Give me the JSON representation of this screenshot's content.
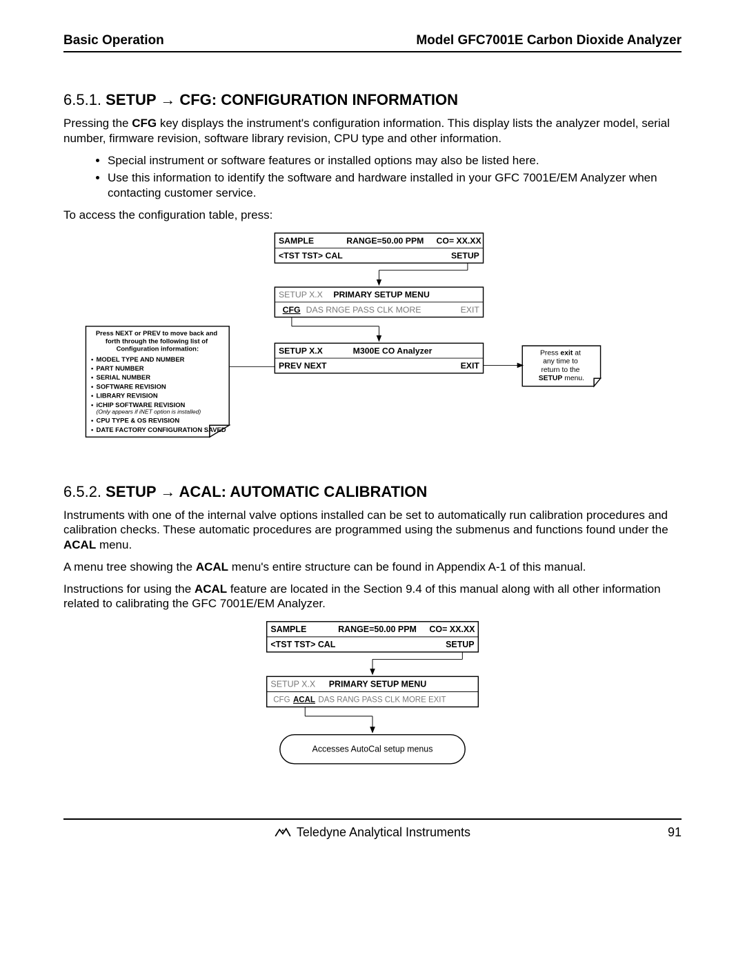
{
  "header": {
    "left": "Basic Operation",
    "right": "Model GFC7001E Carbon Dioxide Analyzer"
  },
  "section_651": {
    "number": "6.5.1.",
    "title_plain": "SETUP → CFG: CONFIGURATION INFORMATION",
    "title_pre": "SETUP ",
    "arrow": "→",
    "title_post": " CFG: CONFIGURATION INFORMATION",
    "para1_pre": "Pressing the ",
    "para1_bold": "CFG",
    "para1_post": " key displays the instrument's configuration information.  This display lists the analyzer model, serial number, firmware revision, software library revision, CPU type and other information.",
    "bullets": [
      "Special instrument or software features or installed options may also be listed here.",
      "Use this information to identify the software and hardware installed in your GFC 7001E/EM Analyzer when contacting customer service."
    ],
    "para2": "To access the configuration table, press:"
  },
  "diagram1": {
    "screen1": {
      "line1_left": "SAMPLE",
      "line1_mid": "RANGE=50.00 PPM",
      "line1_right": "CO= XX.XX",
      "line2_left": "<TST  TST>  CAL",
      "line2_right": "SETUP"
    },
    "screen2": {
      "line1_left": "SETUP X.X",
      "line1_mid": "PRIMARY SETUP MENU",
      "line2_bold": "CFG",
      "line2_rest": "DAS  RNGE  PASS  CLK  MORE",
      "line2_right": "EXIT"
    },
    "screen3": {
      "line1_left": "SETUP X.X",
      "line1_mid": "M300E CO Analyzer",
      "line2_left": "PREV NEXT",
      "line2_right": "EXIT"
    },
    "note_left": {
      "header": "Press NEXT or PREV to move back and forth through the following list of Configuration information:",
      "items": [
        "MODEL TYPE AND NUMBER",
        "PART NUMBER",
        "SERIAL NUMBER",
        "SOFTWARE REVISION",
        "LIBRARY REVISION"
      ],
      "ichip": "iCHIP SOFTWARE REVISION",
      "ichip_note": "(Only appears if iNET option is installed)",
      "items_after": [
        "CPU TYPE & OS REVISION",
        "DATE FACTORY CONFIGURATION SAVED"
      ]
    },
    "note_right": {
      "l1": "Press ",
      "l1b": "exit",
      "l1c": " at",
      "l2": "any time to",
      "l3": "return to the",
      "l4a": "SETUP",
      "l4b": " menu."
    }
  },
  "section_652": {
    "number": "6.5.2.",
    "title_pre": "SETUP ",
    "arrow": "→",
    "title_post": " ACAL: AUTOMATIC CALIBRATION",
    "para1_pre": "Instruments with one of the internal valve options installed can be set to automatically run calibration procedures and calibration checks.  These automatic procedures are programmed using the submenus and functions found under the ",
    "para1_bold": "ACAL",
    "para1_post": " menu.",
    "para2_pre": "A menu tree showing the ",
    "para2_bold": "ACAL",
    "para2_post": " menu's entire structure can be found in Appendix A-1 of this manual.",
    "para3_pre": "Instructions for using the ",
    "para3_bold": "ACAL",
    "para3_post": " feature are located in the Section 9.4 of this manual along with all other information related to calibrating the GFC 7001E/EM Analyzer."
  },
  "diagram2": {
    "screen1": {
      "line1_left": "SAMPLE",
      "line1_mid": "RANGE=50.00 PPM",
      "line1_right": "CO= XX.XX",
      "line2_left": "<TST  TST>  CAL",
      "line2_right": "SETUP"
    },
    "screen2": {
      "line1_left": "SETUP X.X",
      "line1_mid": "PRIMARY SETUP MENU",
      "line2_pre": "CFG ",
      "line2_bold": "ACAL",
      "line2_mid": " DAS  RANG PASS  CLK  MORE  EXIT"
    },
    "bubble": "Accesses AutoCal setup menus"
  },
  "footer": {
    "company": "Teledyne Analytical Instruments",
    "page": "91"
  }
}
